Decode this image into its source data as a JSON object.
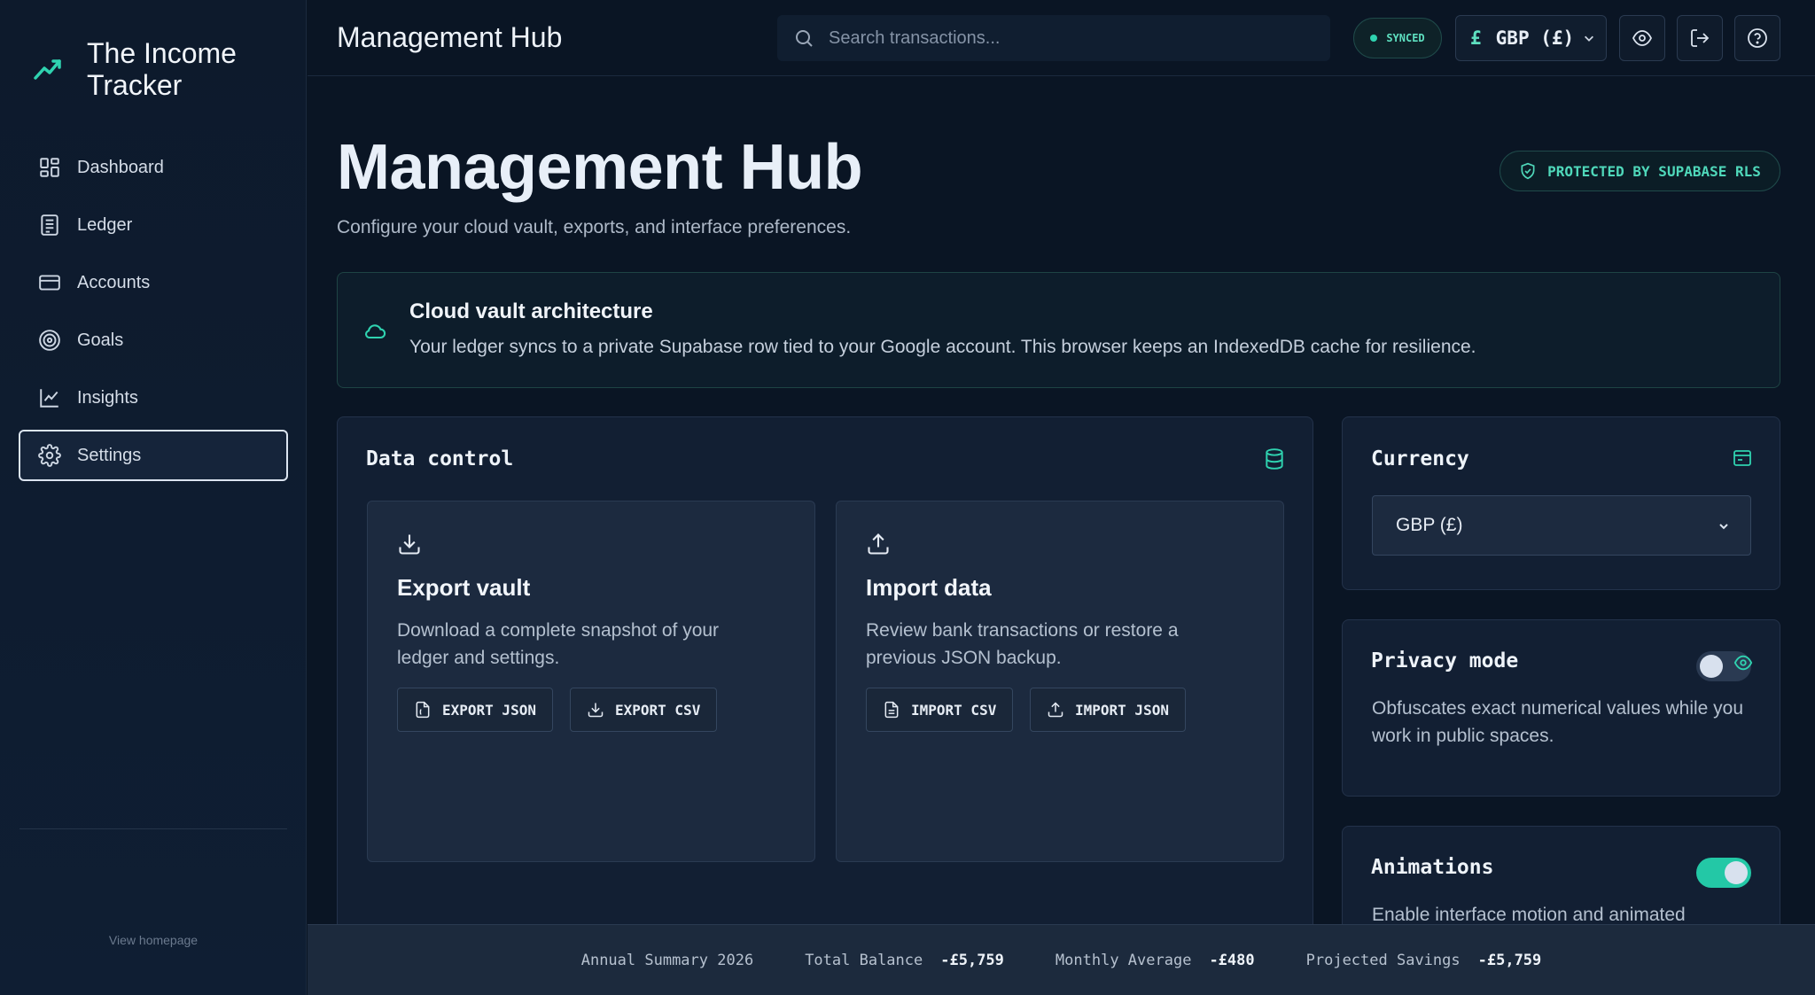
{
  "brand": {
    "title": "The Income Tracker"
  },
  "sidebar": {
    "items": [
      {
        "label": "Dashboard",
        "icon": "dashboard-icon"
      },
      {
        "label": "Ledger",
        "icon": "ledger-icon"
      },
      {
        "label": "Accounts",
        "icon": "card-icon"
      },
      {
        "label": "Goals",
        "icon": "target-icon"
      },
      {
        "label": "Insights",
        "icon": "chart-icon"
      },
      {
        "label": "Settings",
        "icon": "gear-icon",
        "active": true
      }
    ],
    "homepage_link": "View homepage"
  },
  "topbar": {
    "title": "Management Hub",
    "search_placeholder": "Search transactions...",
    "sync_status": "SYNCED",
    "currency_symbol": "£",
    "currency_label": "GBP (£)"
  },
  "page": {
    "heading": "Management Hub",
    "subtitle": "Configure your cloud vault, exports, and interface preferences.",
    "protected_badge": "PROTECTED BY SUPABASE RLS"
  },
  "cloud_notice": {
    "title": "Cloud vault architecture",
    "text": "Your ledger syncs to a private Supabase row tied to your Google account. This browser keeps an IndexedDB cache for resilience."
  },
  "data_control": {
    "title": "Data control",
    "export": {
      "title": "Export vault",
      "description": "Download a complete snapshot of your ledger and settings.",
      "buttons": [
        "EXPORT JSON",
        "EXPORT CSV"
      ]
    },
    "import": {
      "title": "Import data",
      "description": "Review bank transactions or restore a previous JSON backup.",
      "buttons": [
        "IMPORT CSV",
        "IMPORT JSON"
      ]
    }
  },
  "currency_panel": {
    "title": "Currency",
    "selected": "GBP (£)"
  },
  "privacy_panel": {
    "title": "Privacy mode",
    "description": "Obfuscates exact numerical values while you work in public spaces.",
    "enabled": false
  },
  "animations_panel": {
    "title": "Animations",
    "description": "Enable interface motion and animated",
    "enabled": true
  },
  "footer": {
    "summary_label": "Annual Summary 2026",
    "total_balance_label": "Total Balance",
    "total_balance_value": "-£5,759",
    "monthly_average_label": "Monthly Average",
    "monthly_average_value": "-£480",
    "projected_savings_label": "Projected Savings",
    "projected_savings_value": "-£5,759"
  },
  "colors": {
    "accent": "#2fd3b0",
    "background": "#0a1524",
    "panel": "#121f33"
  }
}
